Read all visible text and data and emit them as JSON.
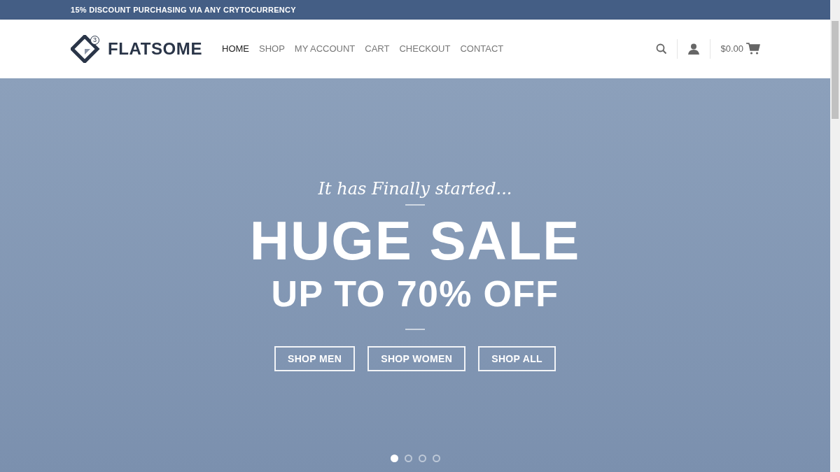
{
  "top_bar": {
    "text": "15% DISCOUNT PURCHASING VIA ANY CRYTOCURRENCY"
  },
  "logo": {
    "badge": "3",
    "name": "FLATSOME"
  },
  "nav": [
    {
      "label": "HOME",
      "selected": true
    },
    {
      "label": "SHOP",
      "selected": false
    },
    {
      "label": "MY ACCOUNT",
      "selected": false
    },
    {
      "label": "CART",
      "selected": false
    },
    {
      "label": "CHECKOUT",
      "selected": false
    },
    {
      "label": "CONTACT",
      "selected": false
    }
  ],
  "cart": {
    "total": "$0.00"
  },
  "hero": {
    "tagline": "It has Finally started...",
    "headline": "HUGE SALE",
    "subheadline": "UP TO 70% OFF",
    "buttons": [
      "SHOP MEN",
      "SHOP WOMEN",
      "SHOP ALL"
    ],
    "slides": [
      {
        "selected": true
      },
      {
        "selected": false
      },
      {
        "selected": false
      },
      {
        "selected": false
      }
    ]
  }
}
